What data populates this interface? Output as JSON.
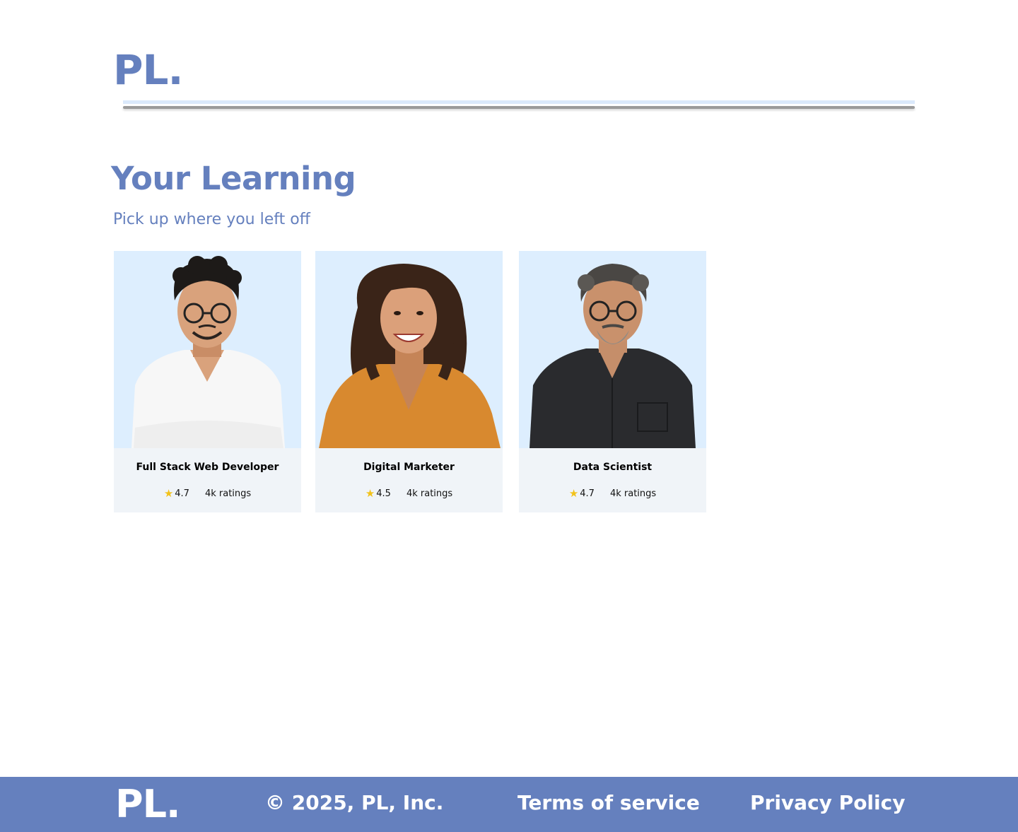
{
  "header": {
    "logo": "PL."
  },
  "main": {
    "title": "Your Learning",
    "subtitle": "Pick up where you left off",
    "courses": [
      {
        "title": "Full Stack Web Developer",
        "rating": "4.7",
        "ratings_count": "4k ratings",
        "shirt_color": "#f7f7f7",
        "hair_color": "#1d1a18"
      },
      {
        "title": "Digital Marketer",
        "rating": "4.5",
        "ratings_count": "4k ratings",
        "shirt_color": "#d8892f",
        "hair_color": "#3a2418"
      },
      {
        "title": "Data Scientist",
        "rating": "4.7",
        "ratings_count": "4k ratings",
        "shirt_color": "#2a2b2e",
        "hair_color": "#4a4744"
      }
    ]
  },
  "footer": {
    "logo": "PL.",
    "copyright": "© 2025, PL, Inc.",
    "terms": "Terms of service",
    "privacy": "Privacy Policy"
  },
  "colors": {
    "brand": "#6580be",
    "card_photo_bg": "#ddeefe",
    "card_info_bg": "#f0f4f8",
    "star": "#f2c21b"
  }
}
